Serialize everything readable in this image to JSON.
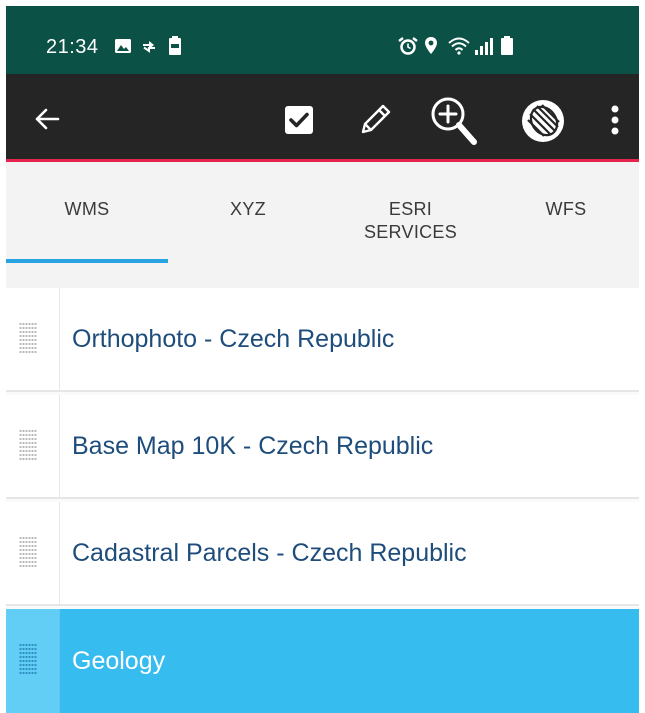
{
  "status_bar": {
    "time": "21:34",
    "left_icons": [
      "image-icon",
      "sync-icon",
      "battery-saver-icon"
    ],
    "right_icons": [
      "alarm-icon",
      "location-icon",
      "wifi-icon",
      "signal-icon",
      "battery-icon"
    ],
    "background": "#0b5146"
  },
  "toolbar": {
    "background": "#262525",
    "accent": "#e6254f",
    "buttons": [
      "back-arrow-icon",
      "checkbox-icon",
      "pencil-icon",
      "zoom-in-icon",
      "globe-icon",
      "more-vert-icon"
    ]
  },
  "tabs": {
    "items": [
      {
        "label": "WMS",
        "selected": true
      },
      {
        "label": "XYZ",
        "selected": false
      },
      {
        "label": "ESRI SERVICES",
        "selected": false
      },
      {
        "label": "WFS",
        "selected": false
      }
    ],
    "indicator_color": "#29a3e0"
  },
  "layers": {
    "items": [
      {
        "label": "Orthophoto - Czech Republic",
        "selected": false
      },
      {
        "label": "Base Map 10K - Czech Republic",
        "selected": false
      },
      {
        "label": "Cadastral Parcels - Czech Republic",
        "selected": false
      },
      {
        "label": "Geology",
        "selected": true
      }
    ],
    "selected_color": "#37bcef",
    "text_color": "#1e4d7c"
  }
}
